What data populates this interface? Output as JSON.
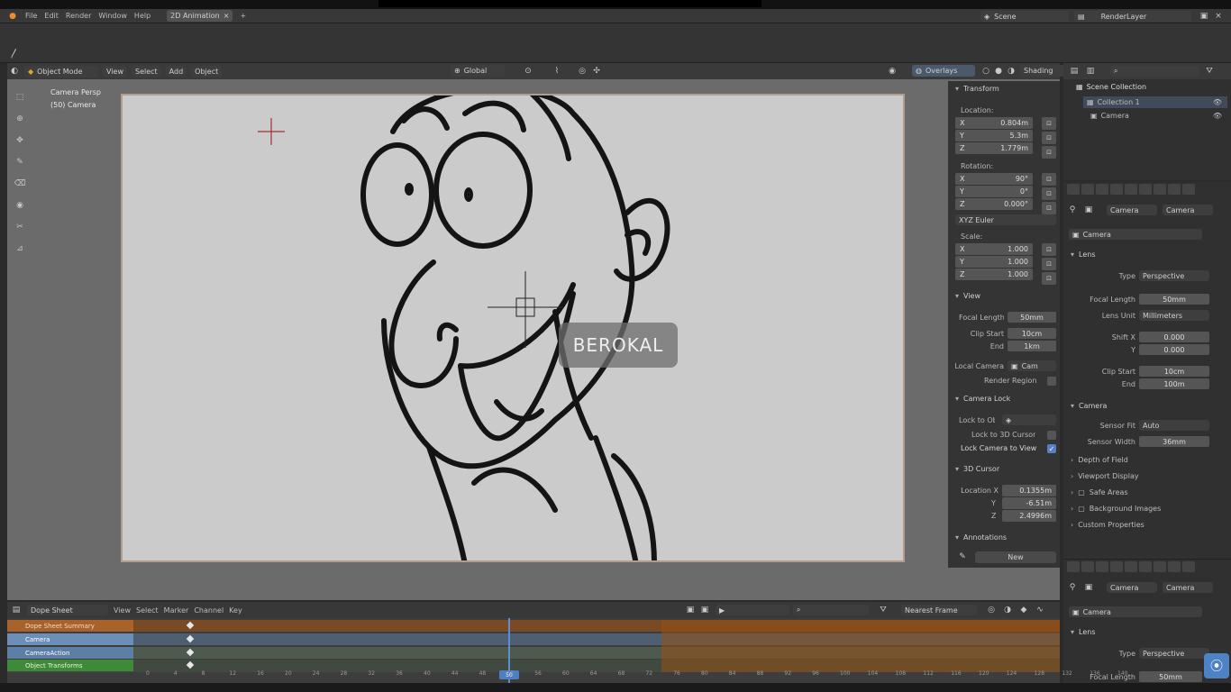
{
  "topbar": {
    "menus": [
      "File",
      "Edit",
      "Render",
      "Window",
      "Help"
    ],
    "workspace": "2D Animation",
    "scene": "Scene",
    "view_layer": "RenderLayer"
  },
  "viewport_header": {
    "mode": "Object Mode",
    "menus": [
      "View",
      "Select",
      "Add",
      "Object"
    ],
    "transform_pivot": "Global",
    "overlays": "Overlays",
    "shading": "Shading"
  },
  "viewport": {
    "view_name": "Camera Persp",
    "collection_label": "(50) Camera",
    "watermark": "BEROKAL"
  },
  "n_panel": {
    "transform_title": "Transform",
    "location_label": "Location:",
    "location": [
      "0.804m",
      "5.3m",
      "1.779m"
    ],
    "location_axes": [
      "X",
      "Y",
      "Z"
    ],
    "rotation_label": "Rotation:",
    "rotation": [
      "90°",
      "0°",
      "0.000°"
    ],
    "rotation_mode": "XYZ Euler",
    "scale_label": "Scale:",
    "scale": [
      "1.000",
      "1.000",
      "1.000"
    ],
    "view_title": "View",
    "focal_length_label": "Focal Length",
    "focal_length": "50mm",
    "clip_start_label": "Clip Start",
    "clip_start": "10cm",
    "clip_end_label": "End",
    "clip_end": "1km",
    "local_camera_label": "Local Camera",
    "local_camera": "Cam",
    "render_region_label": "Render Region",
    "camera_lock_title": "Camera Lock",
    "lock_to_object_label": "Lock to Obj",
    "lock_3d_cursor_label": "Lock to 3D Cursor",
    "lock_camera_view_label": "Lock Camera to View",
    "cursor_title": "3D Cursor",
    "cursor_location_label": "Location X",
    "cursor_location": [
      "0.1355m",
      "-6.51m",
      "2.4996m"
    ],
    "annotations_title": "Annotations",
    "annotations_new": "New"
  },
  "outliner": {
    "scene_collection": "Scene Collection",
    "items": [
      "Collection 1",
      "Camera"
    ]
  },
  "properties_top": {
    "tabs": [
      "Camera",
      "Camera"
    ],
    "object_name": "Camera",
    "lens_title": "Lens",
    "type_label": "Type",
    "type_value": "Perspective",
    "focal_length_label": "Focal Length",
    "focal_length": "50mm",
    "lens_unit_label": "Lens Unit",
    "lens_unit": "Millimeters",
    "shift_x_label": "Shift X",
    "shift_x": "0.000",
    "shift_y_label": "Y",
    "shift_y": "0.000",
    "clip_start_label": "Clip Start",
    "clip_start": "10cm",
    "clip_end_label": "End",
    "clip_end": "100m",
    "camera_title": "Camera",
    "sensor_fit_label": "Sensor Fit",
    "sensor_fit": "Auto",
    "sensor_width_label": "Sensor Width",
    "sensor_width": "36mm",
    "dof_title": "Depth of Field",
    "viewport_display_title": "Viewport Display",
    "safe_areas": "Safe Areas",
    "background_images": "Background Images",
    "custom_properties": "Custom Properties"
  },
  "properties_bottom": {
    "tabs": [
      "Camera",
      "Camera"
    ],
    "object_name": "Camera",
    "lens_title": "Lens",
    "type_label": "Type",
    "type_value": "Perspective",
    "focal_length_label": "Focal Length",
    "focal_length": "50mm"
  },
  "dopesheet": {
    "editor": "Dope Sheet",
    "menus": [
      "View",
      "Select",
      "Marker",
      "Channel",
      "Key"
    ],
    "snap": "Nearest Frame",
    "channels": [
      "Dope Sheet Summary",
      "Camera",
      "CameraAction",
      "Object Transforms"
    ],
    "frames": [
      "0",
      "4",
      "8",
      "12",
      "16",
      "20",
      "24",
      "28",
      "32",
      "36",
      "40",
      "44",
      "48",
      "52",
      "56",
      "60",
      "64",
      "68",
      "72",
      "76",
      "80",
      "84",
      "88",
      "92",
      "96",
      "100",
      "104",
      "108",
      "112",
      "116",
      "120",
      "124",
      "128",
      "132",
      "136",
      "140"
    ],
    "current_frame": "50"
  }
}
